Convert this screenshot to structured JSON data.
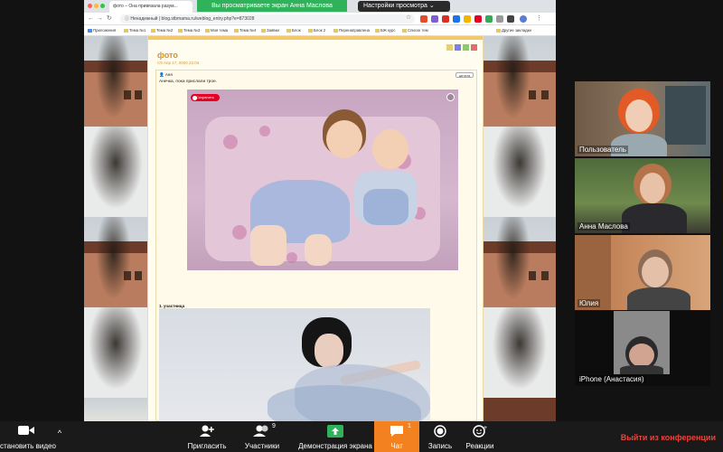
{
  "browser": {
    "tab_title": "фото – Она привязала разум...",
    "share_banner": "Вы просматриваете экран Анна Маслова",
    "view_settings": "Настройки просмотра",
    "secure_label": "Ненадежный",
    "url": "blog.stbmama.ru/weblog_entry.php?e=873028",
    "bookmarks": [
      "Приложения",
      "Тема №1",
      "Тема №2",
      "Тема №3",
      "Моя тема",
      "Тема №4",
      "Заявки",
      "Блок",
      "Блок 2",
      "Перенаправлена",
      "БЖ курс",
      "Список тем"
    ],
    "other_bookmarks": "Другие закладки"
  },
  "post": {
    "title": "фото",
    "meta": "C9 Апр 17, 2020 22:04",
    "author": "Аня",
    "quote_button": "цитата",
    "text": "Анечка, пока прислали трое.",
    "save_pin": "Сохранить",
    "caption_2": "1. участница"
  },
  "participants": [
    {
      "name": "Пользователь"
    },
    {
      "name": "Анна Маслова"
    },
    {
      "name": "Юлия"
    },
    {
      "name": "iPhone (Анастасия)"
    }
  ],
  "toolbar": {
    "video": "становить видео",
    "invite": "Пригласить",
    "participants": "Участники",
    "participants_count": "9",
    "share_screen": "Демонстрация экрана",
    "chat": "Чат",
    "chat_badge": "1",
    "record": "Запись",
    "reactions": "Реакции",
    "leave": "Выйти из конференции"
  },
  "colors": {
    "share_green": "#2fb25a",
    "chat_orange": "#f4811f",
    "leave_red": "#e8453c",
    "blog_accent": "#d4932b"
  }
}
